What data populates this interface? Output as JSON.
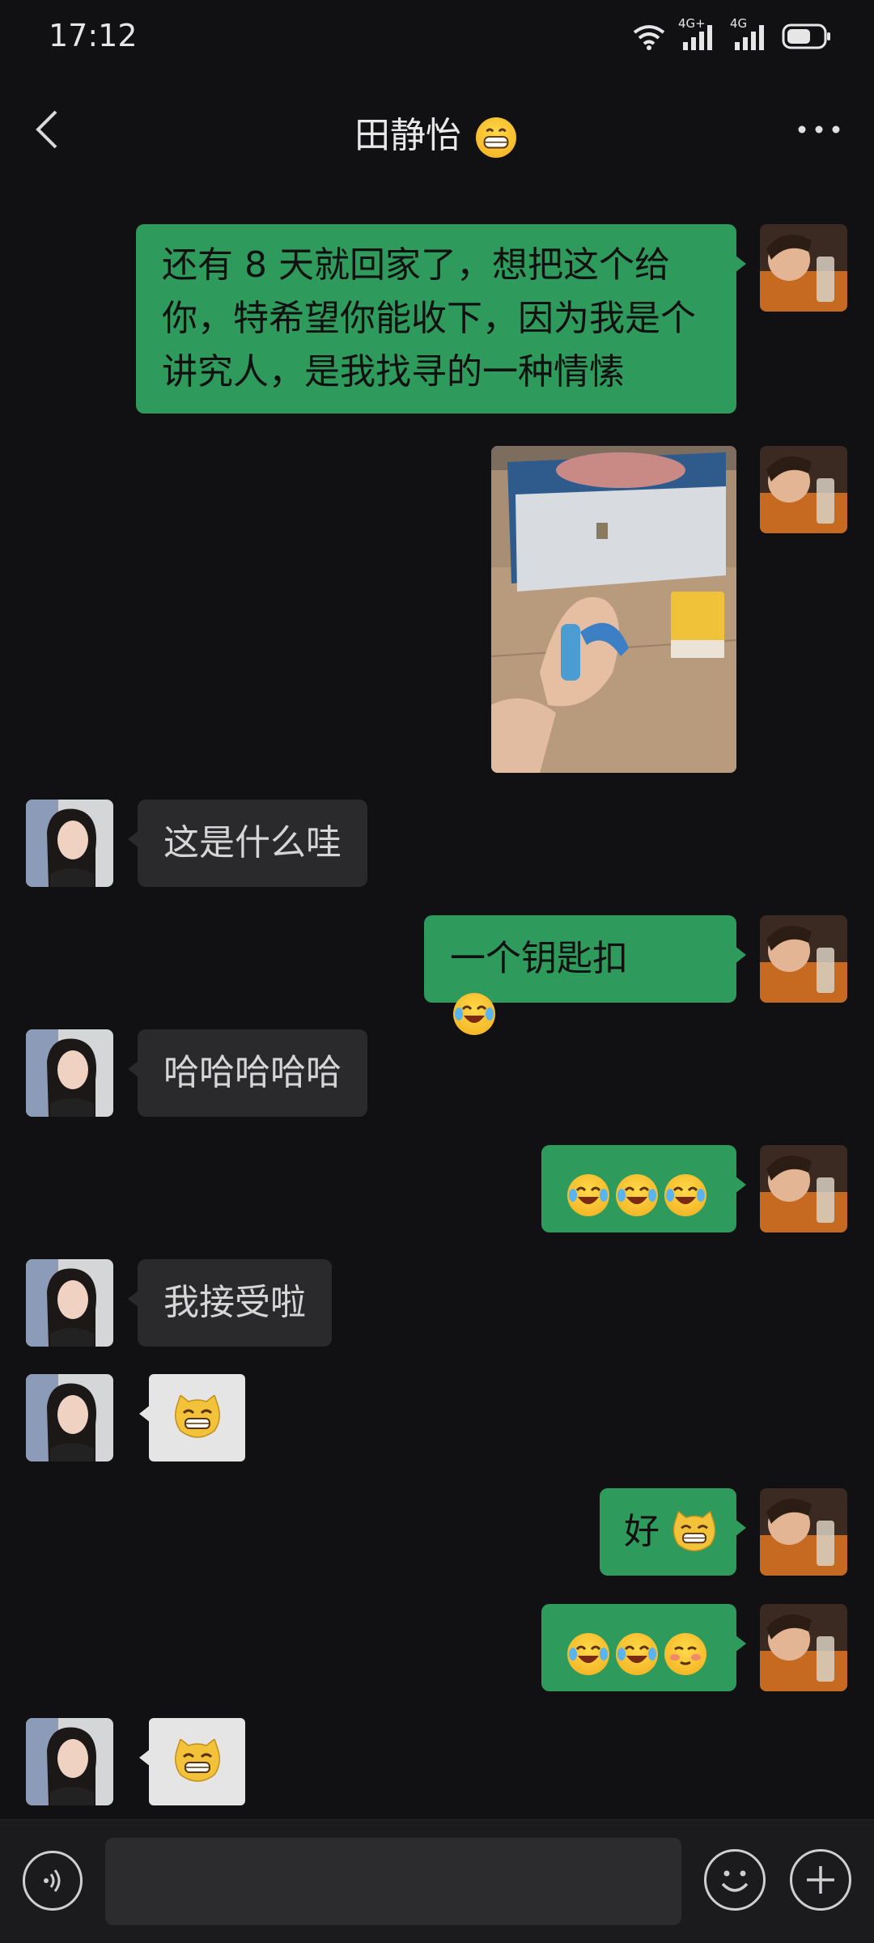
{
  "status_bar": {
    "time": "17:12",
    "network_1": "4G+",
    "network_2": "4G"
  },
  "header": {
    "title": "田静怡",
    "title_emoji": "grin-emoji"
  },
  "messages": [
    {
      "sender": "me",
      "type": "text",
      "text": "还有 8 天就回家了，想把这个给你，特希望你能收下，因为我是个讲究人，是我找寻的一种情愫"
    },
    {
      "sender": "me",
      "type": "image",
      "description_icon": "photo"
    },
    {
      "sender": "her",
      "type": "text",
      "text": "这是什么哇"
    },
    {
      "sender": "me",
      "type": "text",
      "text": "一个钥匙扣",
      "emojis": [
        "tears-of-joy"
      ]
    },
    {
      "sender": "her",
      "type": "text",
      "text": "哈哈哈哈哈"
    },
    {
      "sender": "me",
      "type": "emoji",
      "emojis": [
        "tears-of-joy",
        "tears-of-joy",
        "tears-of-joy"
      ]
    },
    {
      "sender": "her",
      "type": "text",
      "text": "我接受啦"
    },
    {
      "sender": "her",
      "type": "sticker",
      "emojis": [
        "cat-grin"
      ]
    },
    {
      "sender": "me",
      "type": "text",
      "text": "好",
      "emojis": [
        "cat-grin"
      ]
    },
    {
      "sender": "me",
      "type": "emoji",
      "emojis": [
        "tears-of-joy",
        "tears-of-joy",
        "blush-smile"
      ]
    },
    {
      "sender": "her",
      "type": "sticker",
      "emojis": [
        "cat-grin"
      ]
    }
  ],
  "input_bar": {
    "value": "",
    "placeholder": ""
  },
  "colors": {
    "background": "#111113",
    "my_bubble": "#2e9a5c",
    "her_bubble": "#2a2a2c",
    "input_bar": "#1b1b1d"
  }
}
